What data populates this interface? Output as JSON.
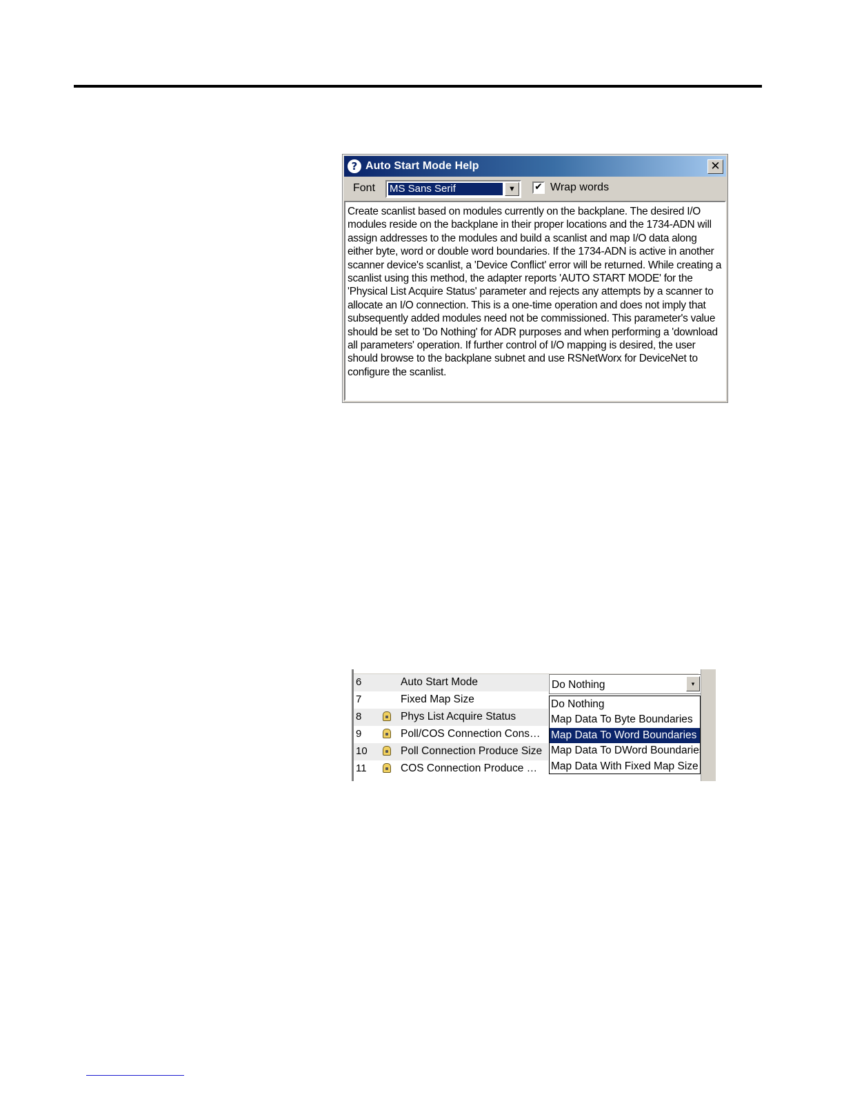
{
  "help_window": {
    "title": "Auto Start Mode Help",
    "title_icon": "?",
    "close_glyph": "✕",
    "font_label": "Font",
    "font_value": "MS Sans Serif",
    "dropdown_glyph": "▼",
    "wrap_checked_glyph": "✔",
    "wrap_label": "Wrap words",
    "body_text": "Create scanlist based on modules currently on the backplane.  The desired I/O modules reside on the backplane in their proper locations and the 1734-ADN will assign addresses to the modules and build a scanlist and map I/O data along either byte, word or double word boundaries.  If the 1734-ADN is active in another scanner device's scanlist, a 'Device Conflict' error will be returned.  While creating a scanlist using this method, the adapter reports 'AUTO START MODE' for the 'Physical List Acquire Status' parameter and rejects any attempts by a scanner to allocate an I/O connection.  This is a one-time operation and does not imply that subsequently added modules need not be commissioned.  This parameter's value should be set to 'Do Nothing' for ADR purposes and when performing a 'download all parameters' operation.  If further control of I/O mapping is desired, the user should browse to the backplane subnet and use RSNetWorx for DeviceNet to configure the scanlist."
  },
  "param_grid": {
    "rows": [
      {
        "num": "6",
        "name": "Auto Start Mode",
        "locked": false
      },
      {
        "num": "7",
        "name": "Fixed Map Size",
        "locked": false
      },
      {
        "num": "8",
        "name": "Phys List Acquire Status",
        "locked": true
      },
      {
        "num": "9",
        "name": "Poll/COS Connection Cons…",
        "locked": true
      },
      {
        "num": "10",
        "name": "Poll Connection Produce Size",
        "locked": true
      },
      {
        "num": "11",
        "name": "COS Connection Produce …",
        "locked": true
      }
    ],
    "current_value": "Do Nothing",
    "dropdown_glyph": "▾",
    "options": [
      "Do Nothing",
      "Map Data To Byte Boundaries",
      "Map Data To Word Boundaries",
      "Map Data To DWord Boundaries",
      "Map Data With Fixed Map Size"
    ],
    "selected_option_index": 2
  }
}
